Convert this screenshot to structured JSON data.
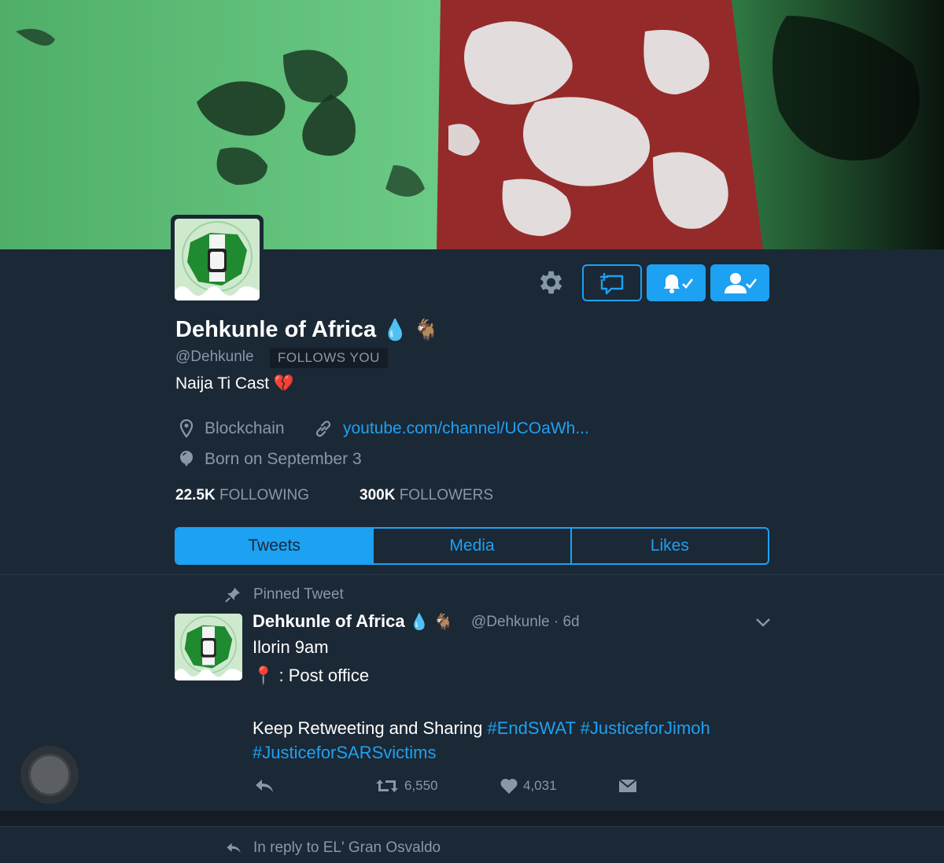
{
  "profile": {
    "name": "Dehkunle of Africa",
    "name_emojis": "💧 🐐",
    "handle": "@Dehkunle",
    "follows_you": "FOLLOWS YOU",
    "bio": "Naija Ti Cast 💔",
    "location": "Blockchain",
    "link": "youtube.com/channel/UCOaWh...",
    "born": "Born on September 3",
    "following_count": "22.5K",
    "following_label": "FOLLOWING",
    "followers_count": "300K",
    "followers_label": "FOLLOWERS"
  },
  "actions": {
    "settings_icon": "gear-icon",
    "message_icon": "compose-message-icon",
    "notifications_icon": "bell-check-icon",
    "follow_icon": "following-user-icon"
  },
  "tabs": [
    {
      "label": "Tweets",
      "active": true
    },
    {
      "label": "Media",
      "active": false
    },
    {
      "label": "Likes",
      "active": false
    }
  ],
  "pinned_tweet": {
    "pinned_label": "Pinned Tweet",
    "author_name": "Dehkunle of Africa",
    "author_emojis": "💧 🐐",
    "author_handle_time": "@Dehkunle · 6d",
    "line1": "Ilorin 9am",
    "line2": "📍 : Post office",
    "line3_text": "Keep Retweeting and Sharing",
    "hashtag1": "#EndSWAT",
    "hashtag2": "#JusticeforJimoh",
    "hashtag3": "#JusticeforSARSvictims",
    "retweets": "6,550",
    "likes": "4,031"
  },
  "next_tweet": {
    "reply_context": "In reply to EL' Gran Osvaldo"
  },
  "colors": {
    "background": "#1b2836",
    "accent": "#1da1f2",
    "muted": "#8899a6",
    "flag_green": "#5fc27a",
    "flag_red": "#9a2a2a"
  }
}
